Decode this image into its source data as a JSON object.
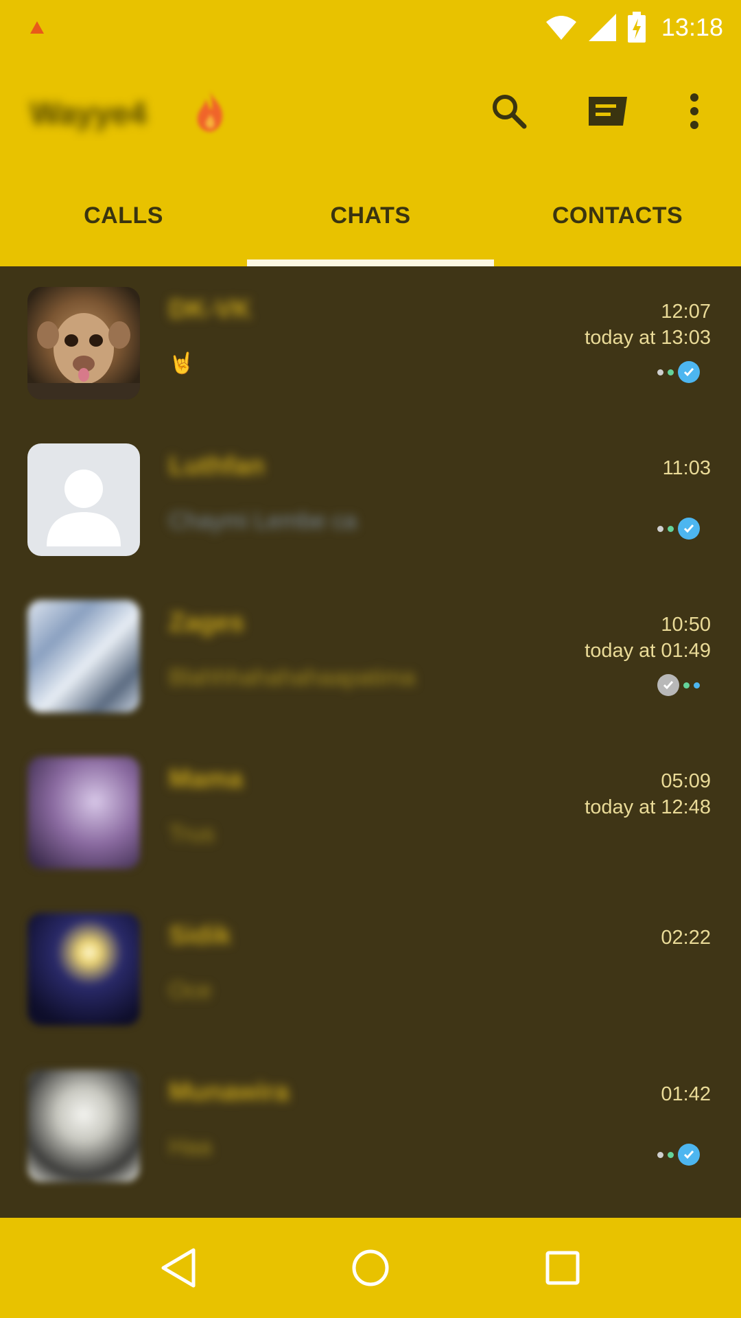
{
  "status_bar": {
    "time": "13:18",
    "icons": [
      "warning-icon",
      "wifi-icon",
      "signal-icon",
      "battery-charging-icon"
    ]
  },
  "app_bar": {
    "profile_name": "Wayye4",
    "actions": [
      "search-icon",
      "new-chat-icon",
      "overflow-menu-icon"
    ]
  },
  "tabs": [
    {
      "label": "CALLS",
      "selected": false
    },
    {
      "label": "CHATS",
      "selected": true
    },
    {
      "label": "CONTACTS",
      "selected": false
    }
  ],
  "chats": [
    {
      "name": "DK-VK",
      "preview": "🤘",
      "time": "12:07",
      "subtime": "today at 13:03",
      "status": "read"
    },
    {
      "name": "Luthfan",
      "preview": "Chaymi Lembe ca",
      "time": "11:03",
      "subtime": "",
      "status": "read"
    },
    {
      "name": "Zages",
      "preview": "Blahhhahahahaapatima",
      "time": "10:50",
      "subtime": "today at 01:49",
      "status": "read-outgoing"
    },
    {
      "name": "Mama",
      "preview": "Trus",
      "time": "05:09",
      "subtime": "today at 12:48",
      "status": "none"
    },
    {
      "name": "Sidik",
      "preview": "Oce",
      "time": "02:22",
      "subtime": "",
      "status": "none"
    },
    {
      "name": "Munawira",
      "preview": "Haa",
      "time": "01:42",
      "subtime": "",
      "status": "read"
    }
  ],
  "nav_bar": [
    "back-icon",
    "home-icon",
    "recents-icon"
  ],
  "colors": {
    "accent": "#e8c200",
    "background": "#3f3516",
    "read_tick": "#4db6f0"
  }
}
